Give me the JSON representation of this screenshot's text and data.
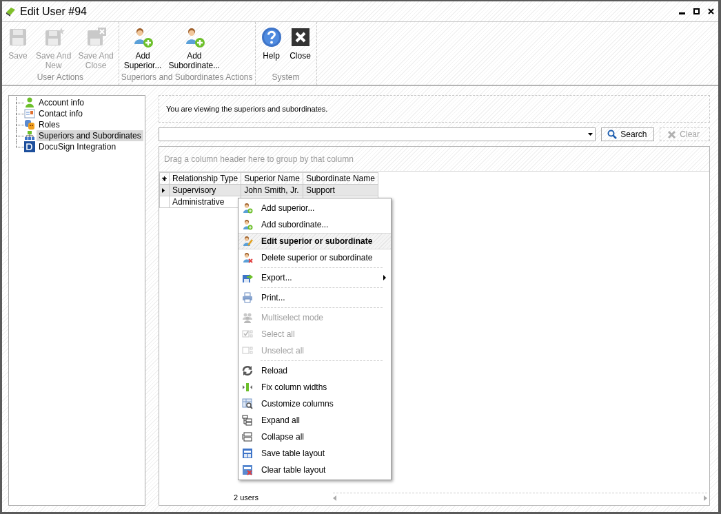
{
  "window": {
    "title": "Edit User #94"
  },
  "ribbon": {
    "groups": [
      {
        "label": "User Actions",
        "buttons": [
          {
            "label": "Save",
            "disabled": true
          },
          {
            "label": "Save And\nNew",
            "disabled": true
          },
          {
            "label": "Save And\nClose",
            "disabled": true
          }
        ]
      },
      {
        "label": "Superiors and Subordinates Actions",
        "buttons": [
          {
            "label": "Add\nSuperior...",
            "disabled": false
          },
          {
            "label": "Add\nSubordinate...",
            "disabled": false
          }
        ]
      },
      {
        "label": "System",
        "buttons": [
          {
            "label": "Help",
            "disabled": false
          },
          {
            "label": "Close",
            "disabled": false
          }
        ]
      }
    ]
  },
  "sidebar": {
    "items": [
      {
        "label": "Account info",
        "selected": false
      },
      {
        "label": "Contact info",
        "selected": false
      },
      {
        "label": "Roles",
        "selected": false
      },
      {
        "label": "Superiors and Subordinates",
        "selected": true
      },
      {
        "label": "DocuSign Integration",
        "selected": false
      }
    ]
  },
  "info": "You are viewing the superiors and subordinates.",
  "search": {
    "button": "Search",
    "clear": {
      "label": "Clear",
      "disabled": true
    }
  },
  "table": {
    "group_hint": "Drag a column header here to group by that column",
    "columns": [
      "Relationship Type",
      "Superior Name",
      "Subordinate Name"
    ],
    "rows": [
      {
        "selected": true,
        "cells": [
          "Supervisory",
          "John Smith, Jr.",
          "Support"
        ]
      },
      {
        "selected": false,
        "cells": [
          "Administrative"
        ]
      }
    ],
    "footer": "2 users"
  },
  "context_menu": {
    "items": [
      {
        "kind": "item",
        "label": "Add superior...",
        "disabled": false,
        "selected": false,
        "submenu": false
      },
      {
        "kind": "item",
        "label": "Add subordinate...",
        "disabled": false,
        "selected": false,
        "submenu": false
      },
      {
        "kind": "item",
        "label": "Edit superior or subordinate",
        "disabled": false,
        "selected": true,
        "submenu": false
      },
      {
        "kind": "item",
        "label": "Delete superior or subordinate",
        "disabled": false,
        "selected": false,
        "submenu": false
      },
      {
        "kind": "separator"
      },
      {
        "kind": "item",
        "label": "Export...",
        "disabled": false,
        "selected": false,
        "submenu": true
      },
      {
        "kind": "separator"
      },
      {
        "kind": "item",
        "label": "Print...",
        "disabled": false,
        "selected": false,
        "submenu": false
      },
      {
        "kind": "separator"
      },
      {
        "kind": "item",
        "label": "Multiselect mode",
        "disabled": true,
        "selected": false,
        "submenu": false
      },
      {
        "kind": "item",
        "label": "Select all",
        "disabled": true,
        "selected": false,
        "submenu": false
      },
      {
        "kind": "item",
        "label": "Unselect all",
        "disabled": true,
        "selected": false,
        "submenu": false
      },
      {
        "kind": "separator"
      },
      {
        "kind": "item",
        "label": "Reload",
        "disabled": false,
        "selected": false,
        "submenu": false
      },
      {
        "kind": "item",
        "label": "Fix column widths",
        "disabled": false,
        "selected": false,
        "submenu": false
      },
      {
        "kind": "item",
        "label": "Customize columns",
        "disabled": false,
        "selected": false,
        "submenu": false
      },
      {
        "kind": "item",
        "label": "Expand all",
        "disabled": false,
        "selected": false,
        "submenu": false
      },
      {
        "kind": "item",
        "label": "Collapse all",
        "disabled": false,
        "selected": false,
        "submenu": false
      },
      {
        "kind": "item",
        "label": "Save table layout",
        "disabled": false,
        "selected": false,
        "submenu": false
      },
      {
        "kind": "item",
        "label": "Clear table layout",
        "disabled": false,
        "selected": false,
        "submenu": false
      }
    ]
  }
}
